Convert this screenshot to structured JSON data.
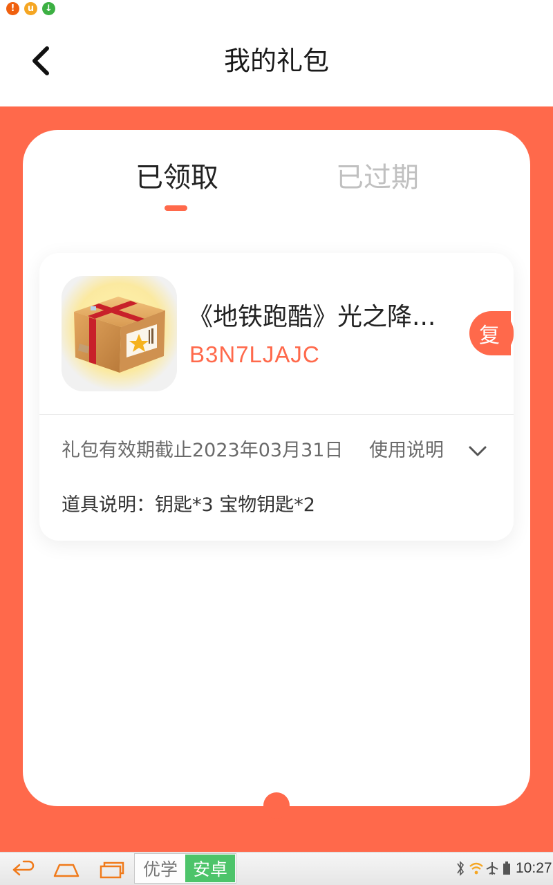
{
  "status_bar": {
    "notifications": [
      {
        "name": "alert-notification-icon",
        "glyph": "!",
        "color": "#f0600f"
      },
      {
        "name": "uc-notification-icon",
        "glyph": "u",
        "color": "#f5a623"
      },
      {
        "name": "download-notification-icon",
        "glyph": "↓",
        "color": "#3cb043"
      }
    ]
  },
  "header": {
    "back_icon": "back-arrow-icon",
    "title": "我的礼包"
  },
  "tabs": [
    {
      "label": "已领取",
      "active": true
    },
    {
      "label": "已过期",
      "active": false
    }
  ],
  "gift": {
    "icon": "gift-box-icon",
    "title": "《地铁跑酷》光之降...",
    "code": "B3N7LJAJC",
    "copy_label": "复",
    "validity": "礼包有效期截止2023年03月31日",
    "usage_label": "使用说明",
    "props_label": "道具说明：钥匙*3 宝物钥匙*2"
  },
  "nav_bar": {
    "ime_left": "优学",
    "ime_right": "安卓",
    "time": "10:27"
  },
  "colors": {
    "accent": "#ff694b",
    "ime_green": "#4dc46a"
  }
}
